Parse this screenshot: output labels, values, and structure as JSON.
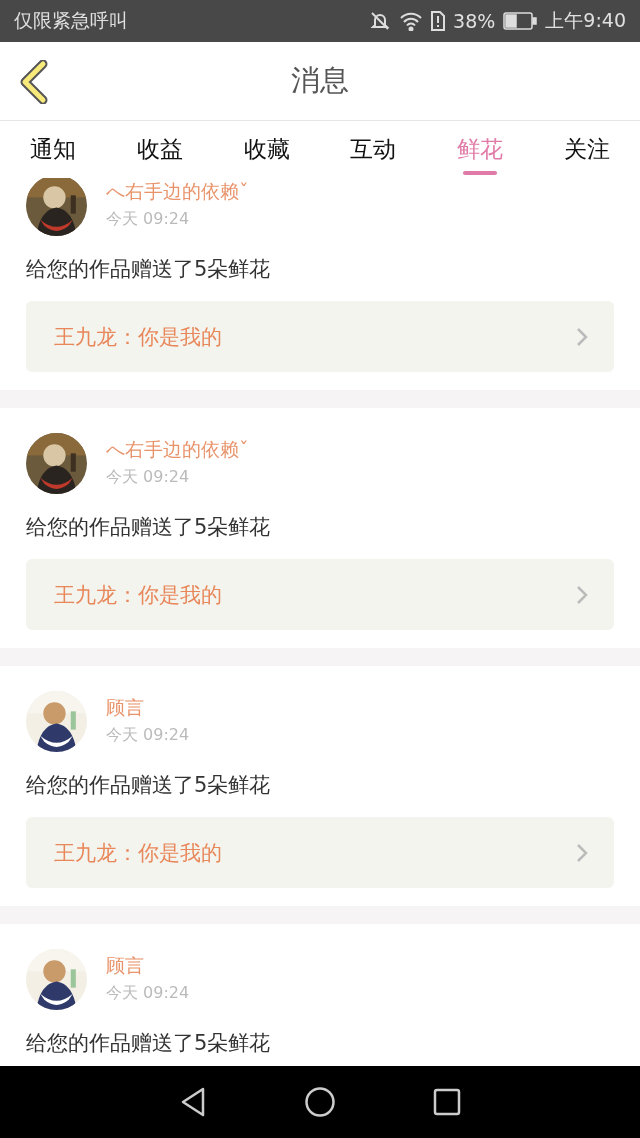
{
  "status_bar": {
    "carrier": "仅限紧急呼叫",
    "battery": "38%",
    "time": "上午9:40"
  },
  "header": {
    "title": "消息"
  },
  "tabs": [
    {
      "label": "通知",
      "selected": false
    },
    {
      "label": "收益",
      "selected": false
    },
    {
      "label": "收藏",
      "selected": false
    },
    {
      "label": "互动",
      "selected": false
    },
    {
      "label": "鲜花",
      "selected": true
    },
    {
      "label": "关注",
      "selected": false
    }
  ],
  "messages": [
    {
      "name": "へ右手边的依赖ˇ",
      "time": "今天 09:24",
      "text": "给您的作品赠送了5朵鲜花",
      "quote": "王九龙：你是我的"
    },
    {
      "name": "へ右手边的依赖ˇ",
      "time": "今天 09:24",
      "text": "给您的作品赠送了5朵鲜花",
      "quote": "王九龙：你是我的"
    },
    {
      "name": "顾言",
      "time": "今天 09:24",
      "text": "给您的作品赠送了5朵鲜花",
      "quote": "王九龙：你是我的"
    },
    {
      "name": "顾言",
      "time": "今天 09:24",
      "text": "给您的作品赠送了5朵鲜花"
    }
  ]
}
